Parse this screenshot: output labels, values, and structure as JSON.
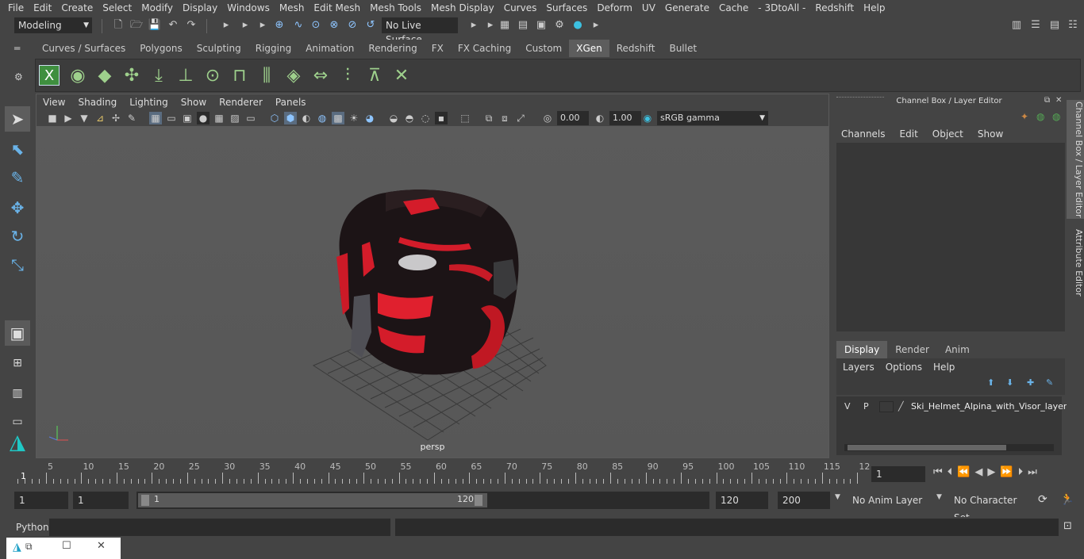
{
  "menubar": {
    "items": [
      "File",
      "Edit",
      "Create",
      "Select",
      "Modify",
      "Display",
      "Windows",
      "Mesh",
      "Edit Mesh",
      "Mesh Tools",
      "Mesh Display",
      "Curves",
      "Surfaces",
      "Deform",
      "UV",
      "Generate",
      "Cache",
      "- 3DtoAll -",
      "Redshift",
      "Help"
    ]
  },
  "statusline": {
    "workspace": "Modeling",
    "live_surface": "No Live Surface"
  },
  "shelf": {
    "tabs": [
      "Curves / Surfaces",
      "Polygons",
      "Sculpting",
      "Rigging",
      "Animation",
      "Rendering",
      "FX",
      "FX Caching",
      "Custom",
      "XGen",
      "Redshift",
      "Bullet"
    ],
    "active_tab": "XGen"
  },
  "viewport": {
    "menu": [
      "View",
      "Shading",
      "Lighting",
      "Show",
      "Renderer",
      "Panels"
    ],
    "exposure": "0.00",
    "gamma": "1.00",
    "color_space": "sRGB gamma",
    "camera_label": "persp"
  },
  "channel_box": {
    "title": "Channel Box / Layer Editor",
    "menu": [
      "Channels",
      "Edit",
      "Object",
      "Show"
    ],
    "layer_tabs": [
      "Display",
      "Render",
      "Anim"
    ],
    "active_layer_tab": "Display",
    "layer_menu": [
      "Layers",
      "Options",
      "Help"
    ],
    "layer": {
      "v": "V",
      "p": "P",
      "name": "Ski_Helmet_Alpina_with_Visor_layer"
    }
  },
  "side_tabs": [
    "Channel Box / Layer Editor",
    "Attribute Editor"
  ],
  "timeslider": {
    "labels": [
      "5",
      "10",
      "15",
      "20",
      "25",
      "30",
      "35",
      "40",
      "45",
      "50",
      "55",
      "60",
      "65",
      "70",
      "75",
      "80",
      "85",
      "90",
      "95",
      "100",
      "105",
      "110",
      "115",
      "12"
    ],
    "start_marker": "1",
    "current_frame": "1"
  },
  "rangeslider": {
    "start": "1",
    "playback_start": "1",
    "range_start_label": "1",
    "range_end_label": "120",
    "playback_end": "120",
    "end": "200",
    "anim_layer": "No Anim Layer",
    "character_set": "No Character Set"
  },
  "cmdline": {
    "label": "Python"
  }
}
